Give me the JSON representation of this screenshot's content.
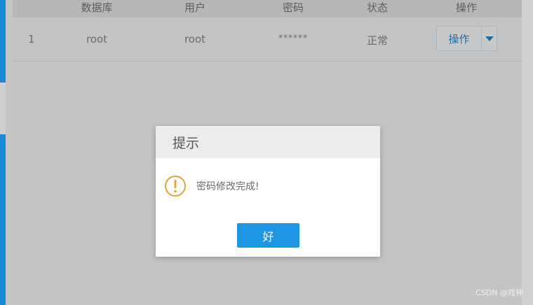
{
  "table": {
    "headers": [
      "数据库",
      "用户",
      "密码",
      "状态",
      "操作"
    ],
    "rows": [
      {
        "index": "1",
        "database": "root",
        "user": "root",
        "password": "******",
        "status": "正常",
        "action_label": "操作"
      }
    ]
  },
  "dialog": {
    "title": "提示",
    "message": "密码修改完成!",
    "ok_label": "好",
    "icon": "warning-circle-icon",
    "accent": "#e8a13a"
  },
  "watermark": "CSDN @戏神",
  "colors": {
    "primary": "#1e96e6",
    "link": "#1f6fa5",
    "overlay": "#c4c4c4"
  }
}
